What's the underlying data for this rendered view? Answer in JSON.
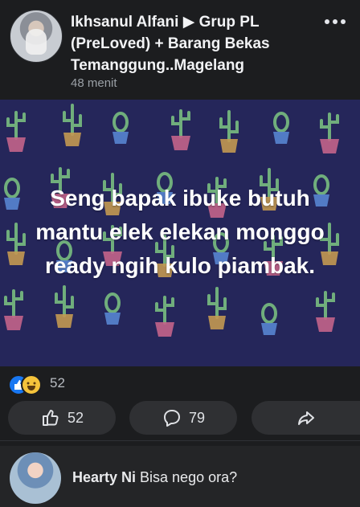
{
  "post": {
    "author": "Ikhsanul Alfani",
    "arrow": "▶",
    "group": "Grup PL (PreLoved) + Barang Bekas Temanggung..Magelang",
    "time": "48 menit",
    "content": "Seng bapak ibuke butuh mantu elek elekan monggo ready ngih kulo piambak.",
    "reaction_count": "52",
    "colors": {
      "background": "#25265a",
      "cactus_green": "#8de38a",
      "cactus_pink": "#ff7b9c",
      "cactus_yellow": "#ffc44f",
      "cactus_blue": "#6aa8ff"
    }
  },
  "actions": {
    "like_count": "52",
    "comment_count": "79"
  },
  "comment": {
    "author": "Hearty Ni",
    "text": "Bisa nego ora?"
  }
}
